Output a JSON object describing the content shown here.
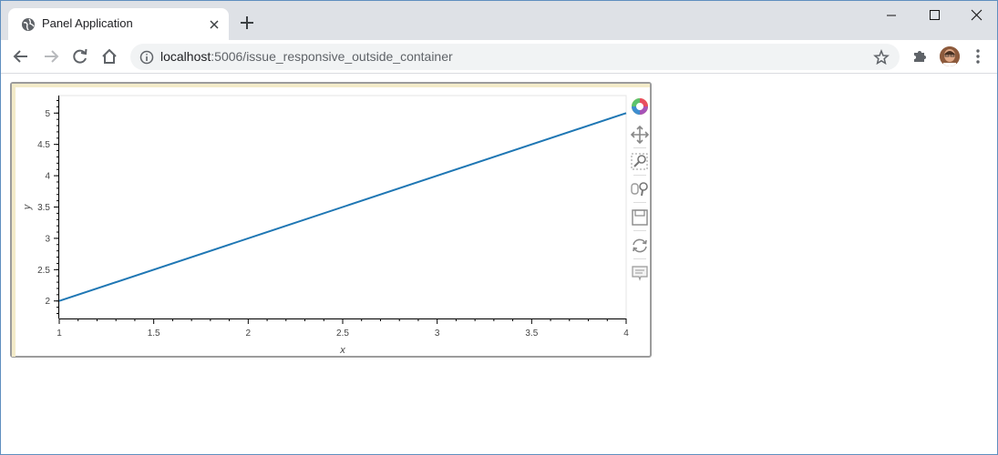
{
  "browser": {
    "tab_title": "Panel Application",
    "url_host": "localhost",
    "url_rest": ":5006/issue_responsive_outside_container"
  },
  "chart_data": {
    "type": "line",
    "x": [
      1,
      4
    ],
    "series": [
      {
        "values": [
          2,
          5
        ]
      }
    ],
    "xlabel": "x",
    "ylabel": "y",
    "xlim": [
      1,
      4
    ],
    "ylim": [
      1.72,
      5.28
    ],
    "xticks": [
      "1",
      "1.5",
      "2",
      "2.5",
      "3",
      "3.5",
      "4"
    ],
    "yticks": [
      "2",
      "2.5",
      "3",
      "3.5",
      "4",
      "4.5",
      "5"
    ],
    "line_color": "#1f77b4",
    "grid": false
  },
  "bokeh_tools": [
    "bokeh-logo-icon",
    "pan-icon",
    "box-zoom-icon",
    "wheel-zoom-icon",
    "save-icon",
    "reset-icon",
    "hover-icon"
  ]
}
